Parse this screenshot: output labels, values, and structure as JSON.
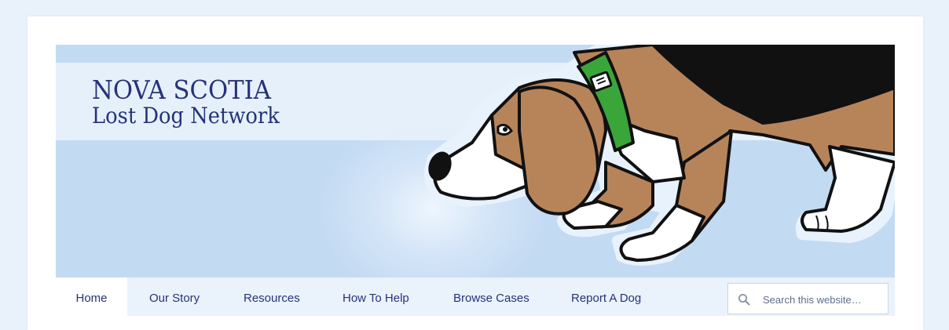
{
  "header": {
    "title_line1": "NOVA SCOTIA",
    "title_line2": "Lost Dog Network",
    "title_color": "#26337a",
    "banner_color": "#c3daf3"
  },
  "nav": {
    "items": [
      {
        "label": "Home",
        "active": true
      },
      {
        "label": "Our Story",
        "active": false
      },
      {
        "label": "Resources",
        "active": false
      },
      {
        "label": "How To Help",
        "active": false
      },
      {
        "label": "Browse Cases",
        "active": false
      },
      {
        "label": "Report A Dog",
        "active": false
      }
    ]
  },
  "search": {
    "placeholder": "Search this website…",
    "value": "",
    "icon": "search-icon"
  },
  "colors": {
    "page_background": "#e9f1fb",
    "accent_navy": "#26337a",
    "collar_green": "#3aa63a"
  }
}
